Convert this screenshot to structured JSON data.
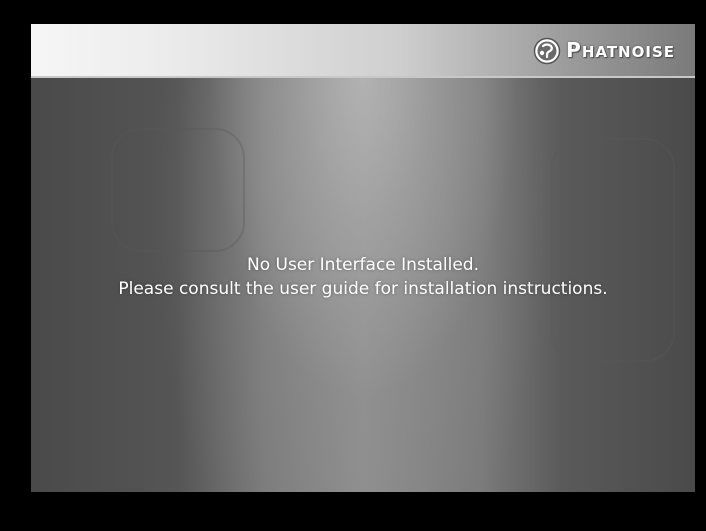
{
  "header": {
    "logo": {
      "icon": "phatnoise-logo-icon",
      "text_first": "P",
      "text_rest": "HATNOISE"
    }
  },
  "main": {
    "message_line1": "No User Interface Installed.",
    "message_line2": "Please consult the user guide for installation instructions."
  },
  "colors": {
    "background": "#000000",
    "header_light": "#f6f6f6",
    "header_dark": "#7a7a7a",
    "panel_gray": "#8e8e8e",
    "text": "#ffffff"
  }
}
